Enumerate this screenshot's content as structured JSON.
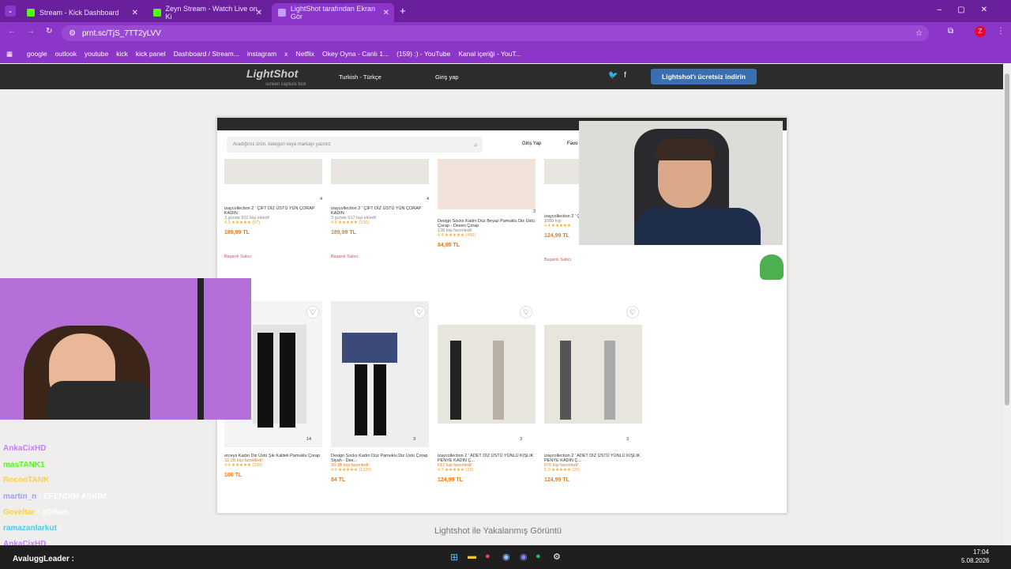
{
  "tabs": [
    {
      "label": "Stream - Kick Dashboard",
      "close": "✕"
    },
    {
      "label": "Zeyn Stream - Watch Live on Ki",
      "close": "✕"
    },
    {
      "label": "LightShot tarafından Ekran Gör",
      "close": "✕"
    }
  ],
  "new_tab": "+",
  "url": "prnt.sc/TjS_7TT2yLVV",
  "bookmarks": [
    "google",
    "outlook",
    "youtube",
    "kick",
    "kick panel",
    "Dashboard / Stream...",
    "instagram",
    "x",
    "Netflix",
    "Okey Oyna - Canlı 1...",
    "(159) :) - YouTube",
    "Kanal içeriği - YouT..."
  ],
  "lightshot": {
    "logo": "LightShot",
    "tagline": "screen capture tool",
    "lang": "Turkish - Türkçe",
    "login": "Giriş yap",
    "download": "Lightshot'ı ücretsiz indirin"
  },
  "shot": {
    "search_placeholder": "Aradığınız ürün, kategori veya markayı yazınız",
    "login": "Giriş Yap",
    "fav": "Favo",
    "row1": [
      {
        "title": "izaycollection 2 ' ÇİFT DİZ ÜSTÜ YÜN ÇORAP KADIN",
        "meta": "3 günde 602 kişi ekledi!",
        "rating": "4.9 ★★★★★ (97)",
        "price": "189,99 TL",
        "badge": "Başarılı Satıcı",
        "count": "4"
      },
      {
        "title": "izaycollection 2 ' ÇİFT DİZ ÜSTÜ YÜN ÇORAP KADIN",
        "meta": "3 günde 617 kişi ekledi!",
        "rating": "4.8 ★★★★★ (106)",
        "price": "189,99 TL",
        "badge": "Başarılı Satıcı",
        "count": "4"
      },
      {
        "title": "Design Socks Kadın Düz Beyaz Pamuklu Diz Üstü Çorap - Desen Çorap",
        "meta": "138 kişi favoriledi!",
        "rating": "4.4 ★★★★★ (490)",
        "price": "84,90 TL",
        "badge": "",
        "count": "3"
      },
      {
        "title": "izaycollection 2 ' ÇİFT DİZ ÜSTÜ YÜNLÜ",
        "meta": "1000 kişi",
        "rating": "4.4 ★★★★★",
        "price": "124,99 TL",
        "badge": "Başarılı Satıcı",
        "count": ""
      }
    ],
    "row2": [
      {
        "title": "erceys Kadın Diz Üstü Şık Kaliteli Pamuklu Çorap",
        "meta": "32,2B kişi favoriledi!",
        "rating": "4.4 ★★★★★ (338)",
        "price": "100 TL",
        "count": "14"
      },
      {
        "title": "Design Socks Kadın Düz Pamuklu Diz Üstü Çorap Siyah - Des...",
        "meta": "20.1B kişi favoriledi!",
        "rating": "4.4 ★★★★★ (1220)",
        "price": "84 TL",
        "count": "3"
      },
      {
        "title": "izaycollection 2 ' ADET DİZ ÜSTÜ YÜNLÜ KIŞLIK PENYE KADIN Ç...",
        "meta": "612 kişi favoriledi!",
        "rating": "4.7 ★★★★★ (32)",
        "price": "124,99 TL",
        "count": "3"
      },
      {
        "title": "izaycollection 2 ' ADET DİZ ÜSTÜ YÜNLÜ KIŞLIK PENYE KADIN Ç...",
        "meta": "676 kişi favoriledi!",
        "rating": "5.0 ★★★★★ (20)",
        "price": "124,99 TL",
        "count": "3"
      }
    ]
  },
  "caption": "Lightshot ile Yakalanmış Görüntü",
  "chat": [
    {
      "user": "AnkaCixHD",
      "msg": ":",
      "color": "#c77dff"
    },
    {
      "user": "masTANK1",
      "msg": ":",
      "color": "#53fc18"
    },
    {
      "user": "RocooTANK",
      "msg": ":",
      "color": "#ffd23f"
    },
    {
      "user": "martin_n",
      "msg": ": EFENDİM AŞKIM",
      "color": "#9aa0ff"
    },
    {
      "user": "Geveltar",
      "msg": ": gürkan",
      "color": "#ffd23f"
    },
    {
      "user": "ramazanlarkut",
      "msg": ":",
      "color": "#4cc9f0"
    },
    {
      "user": "AnkaCixHD",
      "msg": ":",
      "color": "#c77dff"
    },
    {
      "user": "AvaluggLeader",
      "msg": ":",
      "color": "#ffffff"
    }
  ],
  "clock": {
    "time": "17:04",
    "date": "5.08.2026"
  }
}
